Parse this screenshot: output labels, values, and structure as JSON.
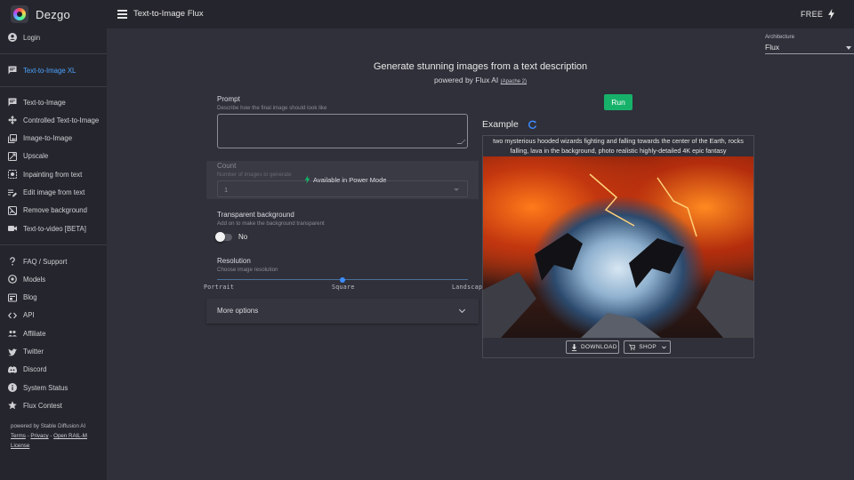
{
  "header": {
    "brand": "Dezgo",
    "page_title": "Text-to-Image Flux",
    "plan_label": "FREE"
  },
  "sidebar": {
    "login": "Login",
    "featured": "Text-to-Image XL",
    "tools": [
      {
        "label": "Text-to-Image",
        "icon": "chat-icon"
      },
      {
        "label": "Controlled Text-to-Image",
        "icon": "move-icon"
      },
      {
        "label": "Image-to-Image",
        "icon": "images-icon"
      },
      {
        "label": "Upscale",
        "icon": "upscale-icon"
      },
      {
        "label": "Inpainting from text",
        "icon": "inpaint-icon"
      },
      {
        "label": "Edit image from text",
        "icon": "edit-icon"
      },
      {
        "label": "Remove background",
        "icon": "remove-bg-icon"
      },
      {
        "label": "Text-to-video [BETA]",
        "icon": "video-icon"
      }
    ],
    "links": [
      {
        "label": "FAQ / Support",
        "icon": "help-icon"
      },
      {
        "label": "Models",
        "icon": "models-icon"
      },
      {
        "label": "Blog",
        "icon": "blog-icon"
      },
      {
        "label": "API",
        "icon": "code-icon"
      },
      {
        "label": "Affiliate",
        "icon": "people-icon"
      },
      {
        "label": "Twitter",
        "icon": "twitter-icon"
      },
      {
        "label": "Discord",
        "icon": "discord-icon"
      },
      {
        "label": "System Status",
        "icon": "info-icon"
      },
      {
        "label": "Flux Contest",
        "icon": "star-icon"
      }
    ],
    "footer": {
      "powered": "powered by Stable Diffusion AI",
      "terms": "Terms",
      "sep1": " - ",
      "privacy": "Privacy",
      "sep2": " - ",
      "license": "Open RAIL-M License"
    }
  },
  "architecture": {
    "label": "Architecture",
    "value": "Flux"
  },
  "hero": {
    "title": "Generate stunning images from a text description",
    "subtitle": "powered by Flux AI",
    "license": "(Apache 2)"
  },
  "form": {
    "prompt_label": "Prompt",
    "prompt_hint": "Describe how the final image should look like",
    "prompt_value": "",
    "run_label": "Run",
    "count_label": "Count",
    "count_hint": "Number of images to generate",
    "count_value": "1",
    "power_mode": "Available in Power Mode",
    "transparent_label": "Transparent background",
    "transparent_hint": "Add on to make the background transparent",
    "transparent_value": "No",
    "resolution_label": "Resolution",
    "resolution_hint": "Choose image resolution",
    "resolution_options": [
      "Portrait",
      "Square",
      "Landscape"
    ],
    "resolution_selected": "Square",
    "more_options": "More options"
  },
  "example": {
    "title": "Example",
    "caption": "two mysterious hooded wizards fighting and falling towards the center of the Earth, rocks falling, lava in the background, photo realistic highly-detailed 4K epic fantasy",
    "download": "DOWNLOAD",
    "shop": "SHOP"
  },
  "colors": {
    "accent_green": "#17b26a",
    "accent_blue": "#4da3ff",
    "sidebar_bg": "#25262d",
    "main_bg": "#2f3039"
  }
}
